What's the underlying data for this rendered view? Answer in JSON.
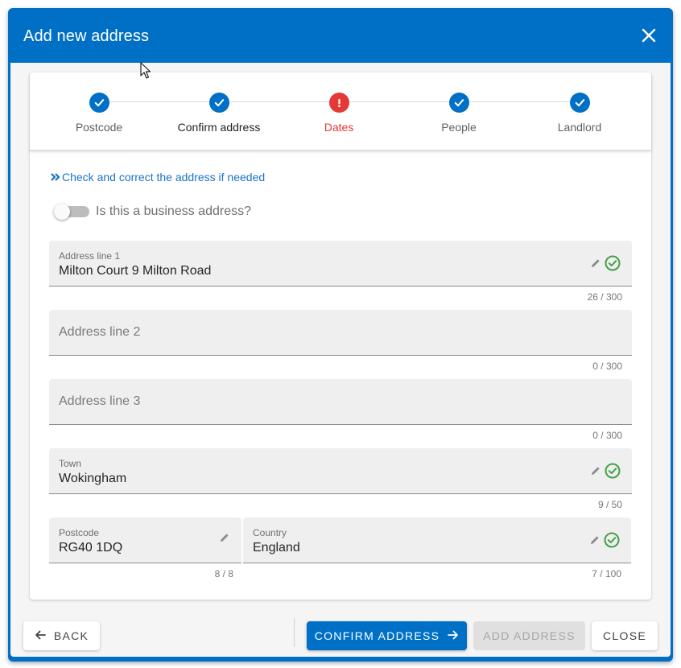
{
  "dialog": {
    "title": "Add new address",
    "accent_color": "#0070c6",
    "close_icon": "close-icon"
  },
  "stepper": {
    "steps": [
      {
        "label": "Postcode",
        "state": "complete",
        "icon": "check-icon"
      },
      {
        "label": "Confirm address",
        "state": "active-complete",
        "icon": "check-icon"
      },
      {
        "label": "Dates",
        "state": "error",
        "icon": "exclamation-icon"
      },
      {
        "label": "People",
        "state": "complete",
        "icon": "check-icon"
      },
      {
        "label": "Landlord",
        "state": "complete",
        "icon": "check-icon"
      }
    ]
  },
  "hint": {
    "text": "Check and correct the address if needed",
    "icon": "double-chevron-right-icon"
  },
  "business_toggle": {
    "label": "Is this a business address?",
    "checked": false
  },
  "fields": {
    "address_line_1": {
      "label": "Address line 1",
      "value": "Milton Court 9 Milton Road",
      "counter": "26 / 300"
    },
    "address_line_2": {
      "placeholder": "Address line 2",
      "value": "",
      "counter": "0 / 300"
    },
    "address_line_3": {
      "placeholder": "Address line 3",
      "value": "",
      "counter": "0 / 300"
    },
    "town": {
      "label": "Town",
      "value": "Wokingham",
      "counter": "9 / 50"
    },
    "postcode": {
      "label": "Postcode",
      "value": "RG40 1DQ",
      "counter": "8 / 8"
    },
    "country": {
      "label": "Country",
      "value": "England",
      "counter": "7 / 100"
    }
  },
  "footer": {
    "back_label": "BACK",
    "confirm_label": "CONFIRM ADDRESS",
    "add_label": "ADD ADDRESS",
    "close_label": "CLOSE"
  },
  "colors": {
    "success": "#43a047",
    "error": "#e53935",
    "link": "#1a73c8"
  }
}
